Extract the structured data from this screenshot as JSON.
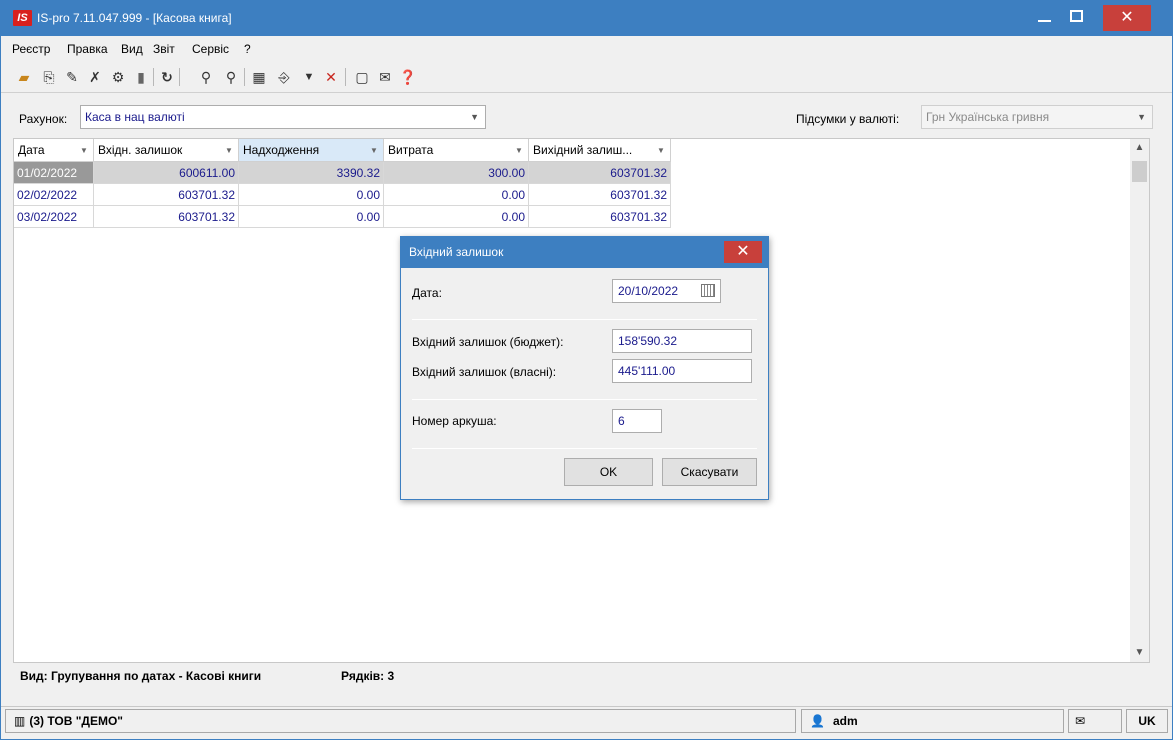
{
  "window": {
    "logo": "IS",
    "title": "IS-pro 7.11.047.999 - [Касова книга]",
    "minimize": "_",
    "close": "✕"
  },
  "menu": [
    "Реєстр",
    "Правка",
    "Вид",
    "Звіт",
    "Сервіс",
    "?"
  ],
  "toolbar": {
    "icons": [
      "open-folder-icon",
      "new-doc-icon",
      "edit-doc-icon",
      "delete-doc-icon",
      "settings-doc-icon",
      "copy-doc-icon",
      "refresh-icon",
      "search-icon",
      "search-next-icon",
      "grid-icon",
      "export-icon",
      "filter-icon",
      "clear-filter-icon",
      "form-icon",
      "mail-icon",
      "help-icon"
    ]
  },
  "filter": {
    "account_label": "Рахунок:",
    "account_value": "Каса в нац валюті",
    "currency_label": "Підсумки у валюті:",
    "currency_value": "Грн Українська гривня"
  },
  "grid": {
    "columns": [
      "Дата",
      "Вхідн. залишок",
      "Надходження",
      "Витрата",
      "Вихідний залиш..."
    ],
    "rows": [
      [
        "01/02/2022",
        "600611.00",
        "3390.32",
        "300.00",
        "603701.32"
      ],
      [
        "02/02/2022",
        "603701.32",
        "0.00",
        "0.00",
        "603701.32"
      ],
      [
        "03/02/2022",
        "603701.32",
        "0.00",
        "0.00",
        "603701.32"
      ]
    ]
  },
  "footer": {
    "view": "Вид: Групування по датах - Касові книги",
    "rows": "Рядків: 3"
  },
  "status": {
    "company": "(3) ТОВ \"ДЕМО\"",
    "user": "adm",
    "lang": "UK"
  },
  "dialog": {
    "title": "Вхідний залишок",
    "date_label": "Дата:",
    "date_value": "20/10/2022",
    "budget_label": "Вхідний залишок (бюджет):",
    "budget_value": "158'590.32",
    "own_label": "Вхідний залишок (власні):",
    "own_value": "445'111.00",
    "sheet_label": "Номер аркуша:",
    "sheet_value": "6",
    "ok": "OK",
    "cancel": "Скасувати"
  }
}
